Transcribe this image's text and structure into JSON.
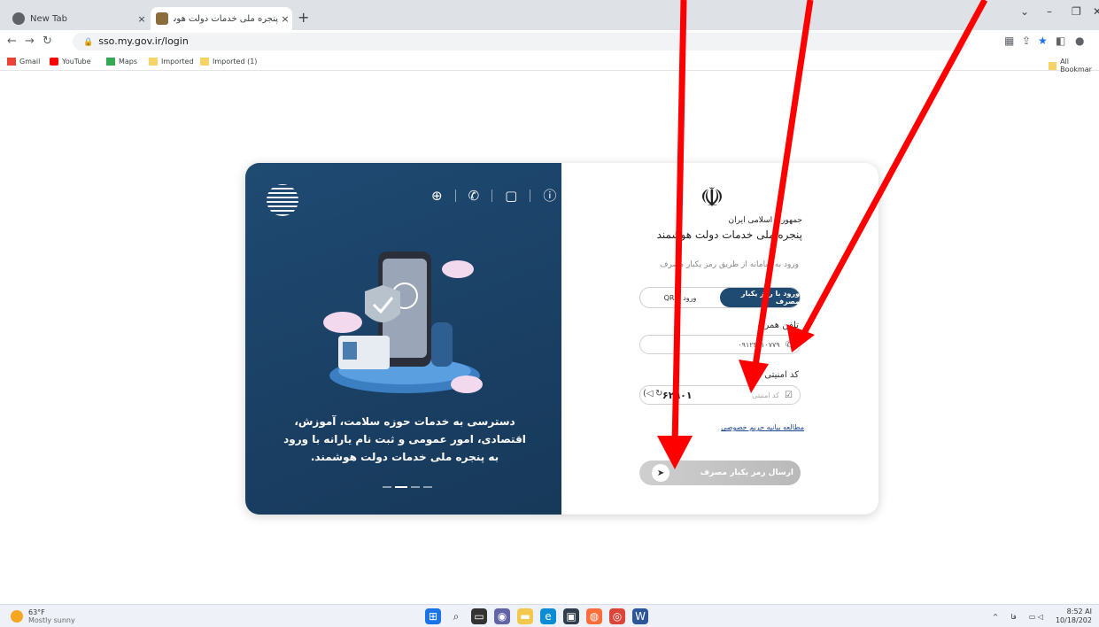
{
  "browser": {
    "tabs": [
      {
        "title": "New Tab",
        "close": "×"
      },
      {
        "title": "پنجره ملی خدمات دولت هوشمند",
        "close": "×"
      }
    ],
    "new_tab": "+",
    "url": "sso.my.gov.ir/login",
    "bookmarks": [
      "Gmail",
      "YouTube",
      "Maps",
      "Imported",
      "Imported (1)"
    ],
    "all_bookmarks": "All Bookmar"
  },
  "promo": {
    "text": "دسترسی به خدمات حوزه سلامت، آموزش، اقتصادی، امور عمومی و ثبت نام یارانه با ورود به پنجره ملی خدمات دولت هوشمند."
  },
  "login": {
    "logo_line1": "جمهوری اسلامی ایران",
    "logo_line2": "پنجره ملی خدمات دولت هوشمند",
    "subtitle": "ورود به سامانه از طریق رمز یکبار مصرف",
    "tab_otp": "ورود با رمز یکبار مصرف",
    "tab_qr": "ورود با QR",
    "phone_label": "تلفن همراه",
    "phone_value": "۰۹۱۲۳۶۱۰۷۷۹",
    "captcha_label": "کد امنیتی",
    "captcha_placeholder": "کد امنیتی",
    "captcha_code": "۶۲۹۰۱",
    "privacy_link": "مطالعه بیانیه حریم خصوصی",
    "send_button": "ارسال رمز یکبار مصرف"
  },
  "taskbar": {
    "temp": "63°F",
    "weather": "Mostly sunny",
    "time": "8:52 AI",
    "date": "10/18/202"
  },
  "colors": {
    "brand_blue": "#1f4a72",
    "arrow_red": "#ff0000"
  }
}
